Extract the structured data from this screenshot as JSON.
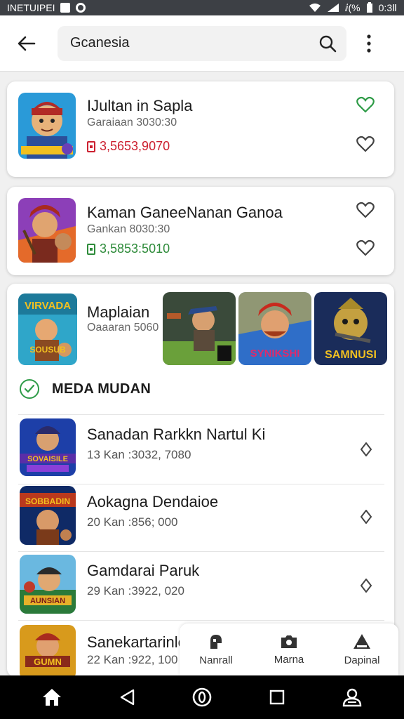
{
  "status_bar": {
    "carrier": "INETUIPEI",
    "clock": "0:3Ⅱ",
    "battery_text": "ⅈ(%",
    "icons": [
      "square-icon",
      "circle-icon",
      "wifi-icon",
      "signal-icon",
      "battery-icon"
    ]
  },
  "app_bar": {
    "search_value": "Gcanesia",
    "icons": [
      "back-arrow-icon",
      "search-icon",
      "more-vert-icon"
    ]
  },
  "cards": [
    {
      "title": "IJultan in Sapla",
      "subtitle": "Garaiaan 3030:30",
      "price": "3,5653,9070",
      "price_color": "#cc2030",
      "hearts": [
        "#2e9b47",
        "#444444"
      ]
    },
    {
      "title": "Kaman GaneeNanan Ganoa",
      "subtitle": "Gankan 8030:30",
      "price": "3,5853:5010",
      "price_color": "#2e8b3a",
      "hearts": [
        "#444444",
        "#444444"
      ]
    }
  ],
  "featured": {
    "title": "Maplaian",
    "subtitle": "Oaaaran 5060",
    "icon_text": "VIRVADA",
    "icon_caption": "SOUSUB",
    "screenshots": [
      "",
      "SYNIKSHI",
      "SAMNUSI"
    ]
  },
  "section": {
    "title": "MEDA MUDAN"
  },
  "list": [
    {
      "title": "Sanadan Rarkkn Nartul Ki",
      "subtitle": "13 Kan :3032, 7080",
      "icon_text": "SOVAISILE",
      "icon_colors": [
        "#1d3fa8",
        "#5a2ea8"
      ]
    },
    {
      "title": "Aokagna Dendaioe",
      "subtitle": "20 Kan :856; 000",
      "icon_text": "SOBBADIN",
      "icon_colors": [
        "#0f2a66",
        "#b9391e"
      ]
    },
    {
      "title": "Gamdarai Paruk",
      "subtitle": "29 Kan :3922, 020",
      "icon_text": "AUNSIAN",
      "icon_colors": [
        "#2b7a3a",
        "#e6b12a"
      ]
    },
    {
      "title": "Sanekartarinlc",
      "subtitle": "22 Kan :922, 100",
      "icon_text": "GUMN",
      "icon_colors": [
        "#d89a1c",
        "#8a2a1a"
      ]
    }
  ],
  "bottom_nav": [
    {
      "label": "Nanrall",
      "icon": "gamepad-icon"
    },
    {
      "label": "Marna",
      "icon": "camera-icon"
    },
    {
      "label": "Dapinal",
      "icon": "warning-icon"
    }
  ],
  "system_nav": [
    "home-icon",
    "back-triangle-icon",
    "assistant-icon",
    "recents-icon",
    "profile-icon"
  ]
}
